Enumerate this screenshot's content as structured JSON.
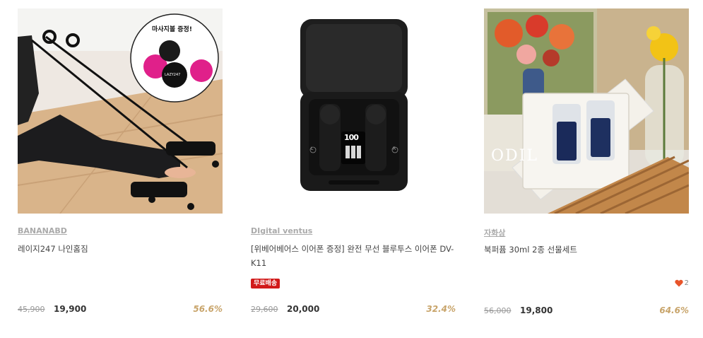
{
  "products": [
    {
      "brand": "BANANABD",
      "title": "레이지247 나인홈짐",
      "thumb_badge": "마사지볼 증정!",
      "ball_logo": "LAZY247",
      "original_price": "45,900",
      "sale_price": "19,900",
      "discount": "56.6%"
    },
    {
      "brand": "DIgital ventus",
      "title": "[위베어베어스 이어폰 증정] 완전 무선 블루투스 이어폰 DV-K11",
      "tag": "무료배송",
      "display_readout": "100",
      "earbud_left": "L",
      "earbud_right": "R",
      "original_price": "29,600",
      "sale_price": "20,000",
      "discount": "32.4%"
    },
    {
      "brand": "자화상",
      "title": "북퍼퓸 30ml 2종 선물세트",
      "poster_text": "ODIL",
      "like_count": "2",
      "original_price": "56,000",
      "sale_price": "19,800",
      "discount": "64.6%"
    }
  ],
  "colors": {
    "discount": "#c8a46a",
    "free_shipping_badge": "#d11a1a",
    "heart": "#e8542a"
  }
}
